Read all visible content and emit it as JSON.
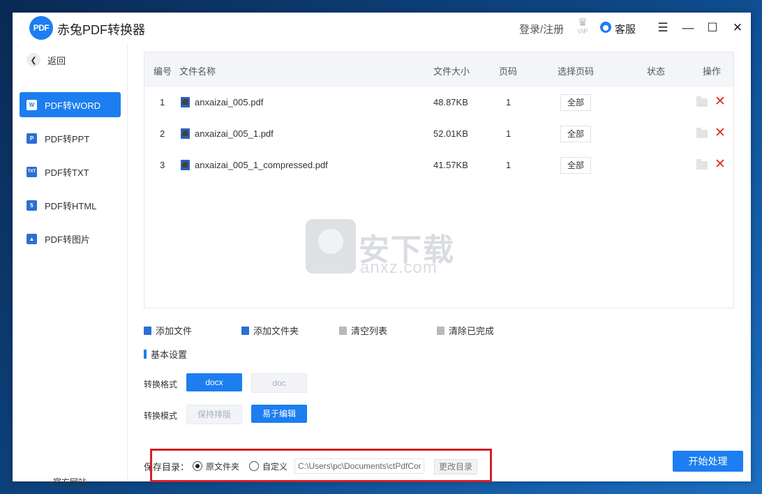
{
  "app": {
    "logo_text": "PDF",
    "title": "赤兔PDF转换器"
  },
  "header": {
    "login": "登录/注册",
    "vip_badge": "VIP",
    "service": "客服"
  },
  "window_controls": {
    "menu": "☰",
    "minimize": "—",
    "maximize": "☐",
    "close": "✕"
  },
  "sidebar": {
    "back": "返回",
    "items": [
      {
        "label": "PDF转WORD",
        "icon": "word-icon",
        "icon_text": "W",
        "active": true
      },
      {
        "label": "PDF转PPT",
        "icon": "ppt-icon",
        "icon_text": "P",
        "active": false
      },
      {
        "label": "PDF转TXT",
        "icon": "txt-icon",
        "icon_text": "TXT",
        "active": false
      },
      {
        "label": "PDF转HTML",
        "icon": "html-icon",
        "icon_text": "5",
        "active": false
      },
      {
        "label": "PDF转图片",
        "icon": "image-icon",
        "icon_text": "▲",
        "active": false
      }
    ],
    "official_site": "官方网站"
  },
  "table": {
    "columns": [
      "编号",
      "文件名称",
      "文件大小",
      "页码",
      "选择页码",
      "状态",
      "操作"
    ],
    "rows": [
      {
        "no": "1",
        "name": "anxaizai_005.pdf",
        "size": "48.87KB",
        "pages": "1",
        "page_select": "全部",
        "status": ""
      },
      {
        "no": "2",
        "name": "anxaizai_005_1.pdf",
        "size": "52.01KB",
        "pages": "1",
        "page_select": "全部",
        "status": ""
      },
      {
        "no": "3",
        "name": "anxaizai_005_1_compressed.pdf",
        "size": "41.57KB",
        "pages": "1",
        "page_select": "全部",
        "status": ""
      }
    ]
  },
  "watermark": {
    "cn": "安下载",
    "en": "anxz.com",
    "shield_char": "安"
  },
  "toolbar": {
    "add_file": "添加文件",
    "add_folder": "添加文件夹",
    "clear_list": "清空列表",
    "clear_done": "清除已完成"
  },
  "settings": {
    "title": "基本设置",
    "format_label": "转换格式",
    "format_options": [
      "docx",
      "doc"
    ],
    "mode_label": "转换模式",
    "mode_options": [
      "保持排版",
      "易于编辑"
    ]
  },
  "save": {
    "label": "保存目录：",
    "option_original": "原文件夹",
    "option_custom": "自定义",
    "path_value": "C:\\Users\\pc\\Documents\\ctPdfConverter",
    "change_button": "更改目录"
  },
  "start_button": "开始处理"
}
